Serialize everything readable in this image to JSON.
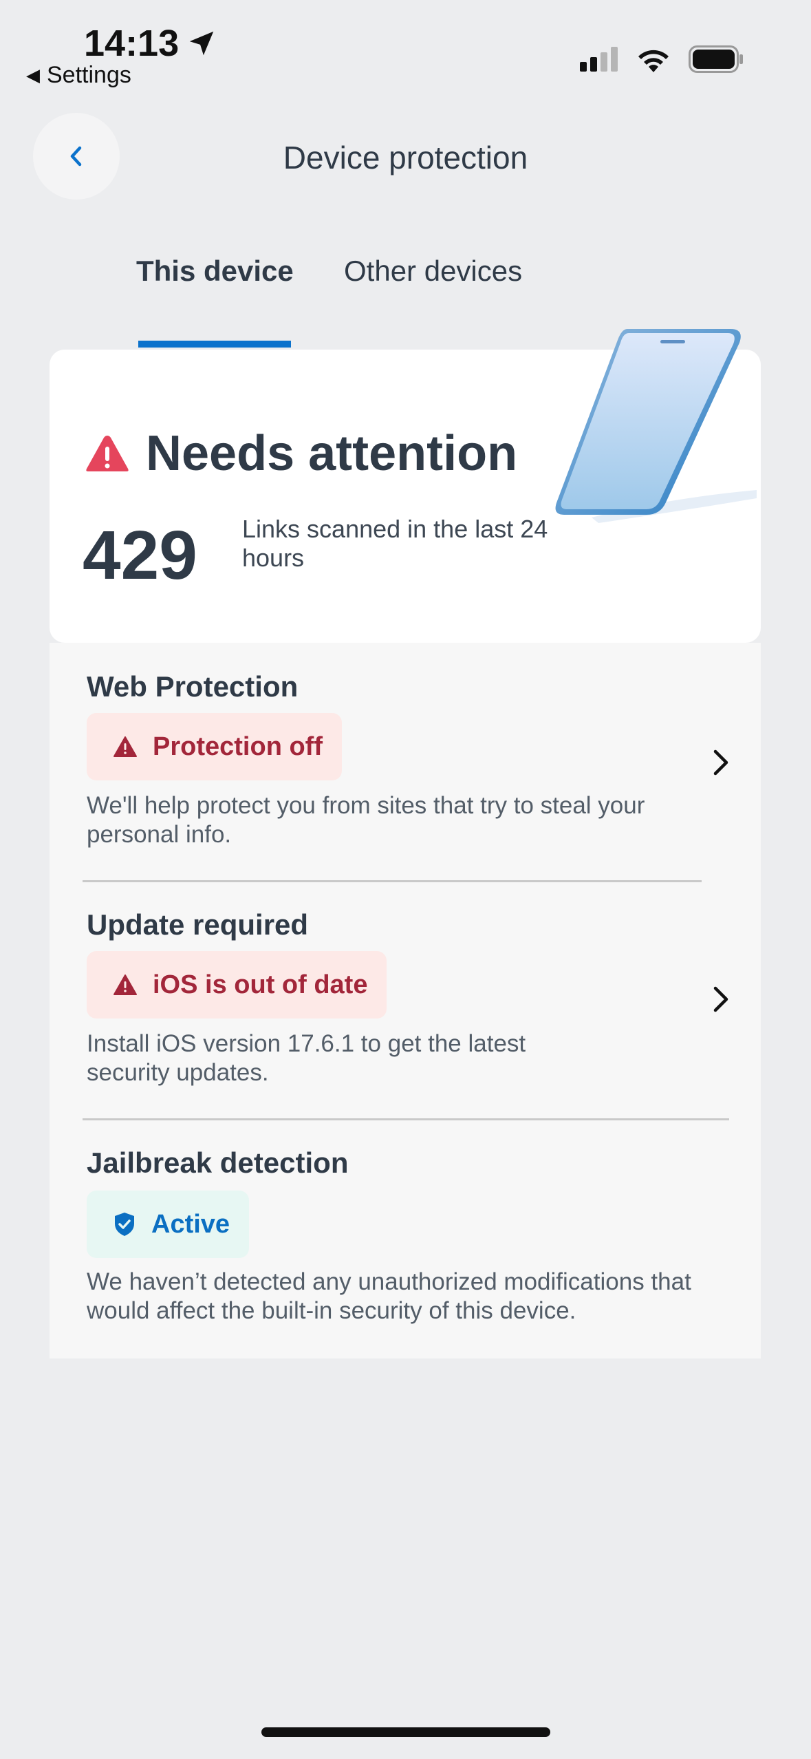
{
  "status_bar": {
    "time": "14:13",
    "back_label": "Settings"
  },
  "header": {
    "title": "Device protection"
  },
  "tabs": [
    {
      "label": "This device",
      "selected": true
    },
    {
      "label": "Other devices",
      "selected": false
    }
  ],
  "summary": {
    "status_title": "Needs attention",
    "links_count": "429",
    "links_label": "Links scanned in the last 24 hours"
  },
  "sections": [
    {
      "title": "Web Protection",
      "badge": "Protection off",
      "badge_type": "danger",
      "description": "We'll help protect you from sites that try to steal your personal info."
    },
    {
      "title": "Update required",
      "badge": "iOS is out of date",
      "badge_type": "danger",
      "description": "Install iOS version 17.6.1 to get the latest security updates."
    },
    {
      "title": "Jailbreak detection",
      "badge": "Active",
      "badge_type": "ok",
      "description": "We haven’t detected any unauthorized modifications that would affect the built-in security of this device."
    }
  ],
  "colors": {
    "accent": "#0b72cc",
    "danger_text": "#a2263a",
    "danger_bg": "#fde9e7",
    "ok_bg": "#e7f7f3",
    "warning_icon": "#e5455c"
  }
}
